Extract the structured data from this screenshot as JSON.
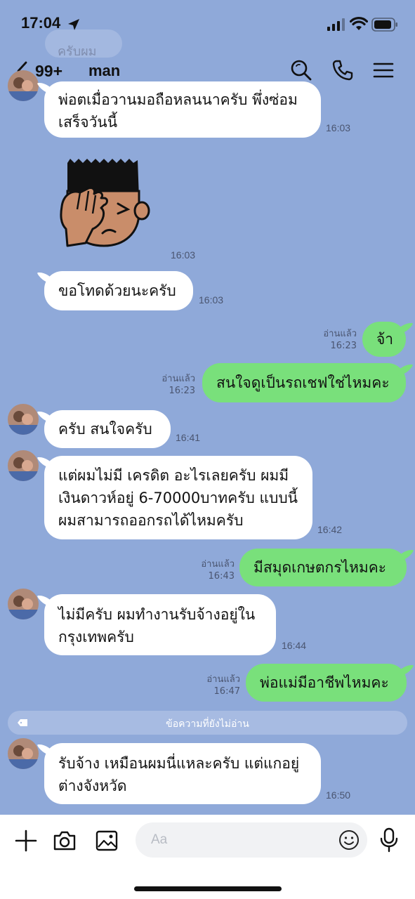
{
  "status_bar": {
    "time": "17:04"
  },
  "background_hint": {
    "top_ghost": "ครับผม"
  },
  "header": {
    "back_count": "99+",
    "title": "man"
  },
  "messages": [
    {
      "side": "in",
      "text": "พ่อตเมื่อวานมอถือหลนนาครับ พึ่งซ่อมเสร็จวันนี้",
      "time": "16:03"
    },
    {
      "side": "in",
      "type": "sticker",
      "time": "16:03"
    },
    {
      "side": "in",
      "text": "ขอโทดด้วยนะครับ",
      "time": "16:03"
    },
    {
      "side": "out",
      "text": "จ้า",
      "read": "อ่านแล้ว",
      "time": "16:23"
    },
    {
      "side": "out",
      "text": "สนใจดูเป็นรถเชฟใช่ไหมคะ",
      "read": "อ่านแล้ว",
      "time": "16:23"
    },
    {
      "side": "in",
      "text": "ครับ สนใจครับ",
      "time": "16:41"
    },
    {
      "side": "in",
      "text": "แต่ผมไม่มี เครดิต อะไรเลยครับ ผมมีเงินดาวห์อยู่ 6-70000บาทครับ แบบนี้ผมสามารถออกรถได้ไหมครับ",
      "time": "16:42"
    },
    {
      "side": "out",
      "text": "มีสมุดเกษตกรไหมคะ",
      "read": "อ่านแล้ว",
      "time": "16:43"
    },
    {
      "side": "in",
      "text": "ไม่มีครับ ผมทำงานรับจ้างอยู่ในกรุงเทพครับ",
      "time": "16:44"
    },
    {
      "side": "out",
      "text": "พ่อแม่มีอาชีพไหมคะ",
      "read": "อ่านแล้ว",
      "time": "16:47"
    },
    {
      "side": "in",
      "text": "รับจ้าง เหมือนผมนี่แหละครับ แต่แกอยู่ต่างจังหวัด",
      "time": "16:50"
    }
  ],
  "unread_divider": "ข้อความที่ยังไม่อ่าน",
  "input": {
    "placeholder": "Aa"
  },
  "colors": {
    "background": "#8fa9d9",
    "outgoing": "#79e07b",
    "incoming": "#ffffff"
  }
}
